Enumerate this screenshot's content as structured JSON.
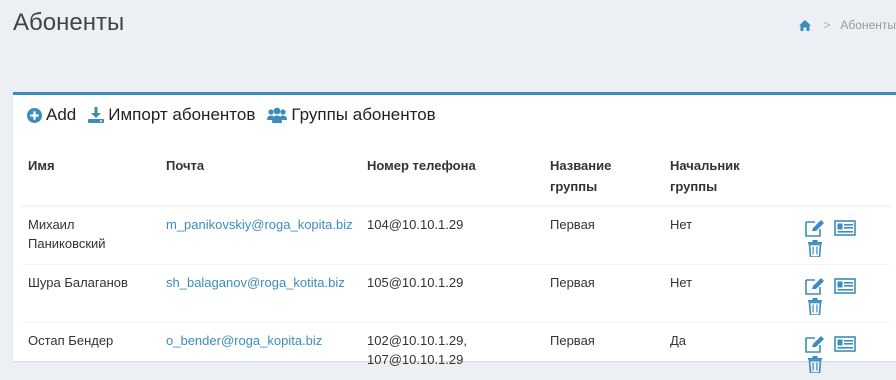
{
  "page": {
    "title": "Абоненты"
  },
  "breadcrumb": {
    "home_icon": "home-icon",
    "separator": ">",
    "current": "Абоненты"
  },
  "toolbar": {
    "add_label": "Add",
    "import_label": "Импорт абонентов",
    "groups_label": "Группы абонентов"
  },
  "table": {
    "headers": {
      "name": "Имя",
      "email": "Почта",
      "phone": "Номер телефона",
      "group_line1": "Название",
      "group_line2": "группы",
      "head_line1": "Начальник",
      "head_line2": "группы"
    },
    "rows": [
      {
        "name_line1": "Михаил",
        "name_line2": "Паниковский",
        "email": "m_panikovskiy@roga_kopita.biz",
        "phone_line1": "104@10.10.1.29",
        "phone_line2": "",
        "group": "Первая",
        "head": "Нет"
      },
      {
        "name_line1": "Шура Балаганов",
        "name_line2": "",
        "email": "sh_balaganov@roga_kotita.biz",
        "phone_line1": "105@10.10.1.29",
        "phone_line2": "",
        "group": "Первая",
        "head": "Нет"
      },
      {
        "name_line1": "Остап Бендер",
        "name_line2": "",
        "email": "o_bender@roga_kopita.biz",
        "phone_line1": "102@10.10.1.29,",
        "phone_line2": "107@10.10.1.29",
        "group": "Первая",
        "head": "Да"
      }
    ]
  },
  "icons": {
    "edit": "edit-icon",
    "card": "card-icon",
    "delete": "trash-icon",
    "add": "plus-circle-icon",
    "import": "download-icon",
    "groups": "users-icon"
  },
  "colors": {
    "accent": "#3c8dbc",
    "background": "#ecf0f5",
    "box_top_border": "#3c8dbc"
  }
}
